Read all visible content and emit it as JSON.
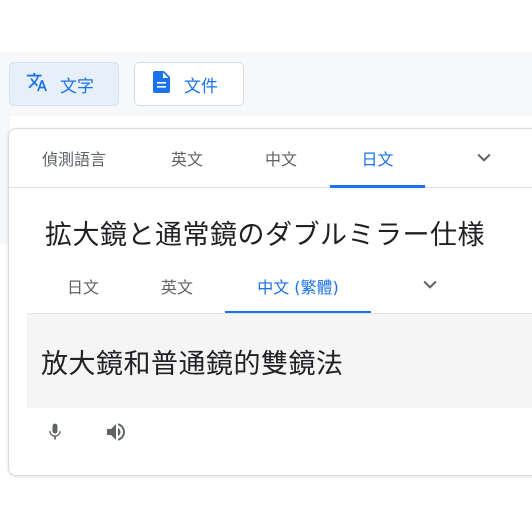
{
  "mode_tabs": {
    "text_label": "文字",
    "document_label": "文件"
  },
  "source": {
    "langs": [
      "偵測語言",
      "英文",
      "中文",
      "日文"
    ],
    "active_index": 3,
    "text": "拡大鏡と通常鏡のダブルミラー仕様"
  },
  "target": {
    "langs": [
      "日文",
      "英文",
      "中文 (繁體)"
    ],
    "active_index": 2,
    "text": "放大鏡和普通鏡的雙鏡法"
  },
  "icons": {
    "translate": "translate-icon",
    "document": "document-icon",
    "chevron": "chevron-down-icon",
    "mic": "microphone-icon",
    "speaker": "speaker-icon"
  },
  "colors": {
    "accent": "#1a73e8",
    "text": "#202124",
    "muted": "#5f6368"
  }
}
